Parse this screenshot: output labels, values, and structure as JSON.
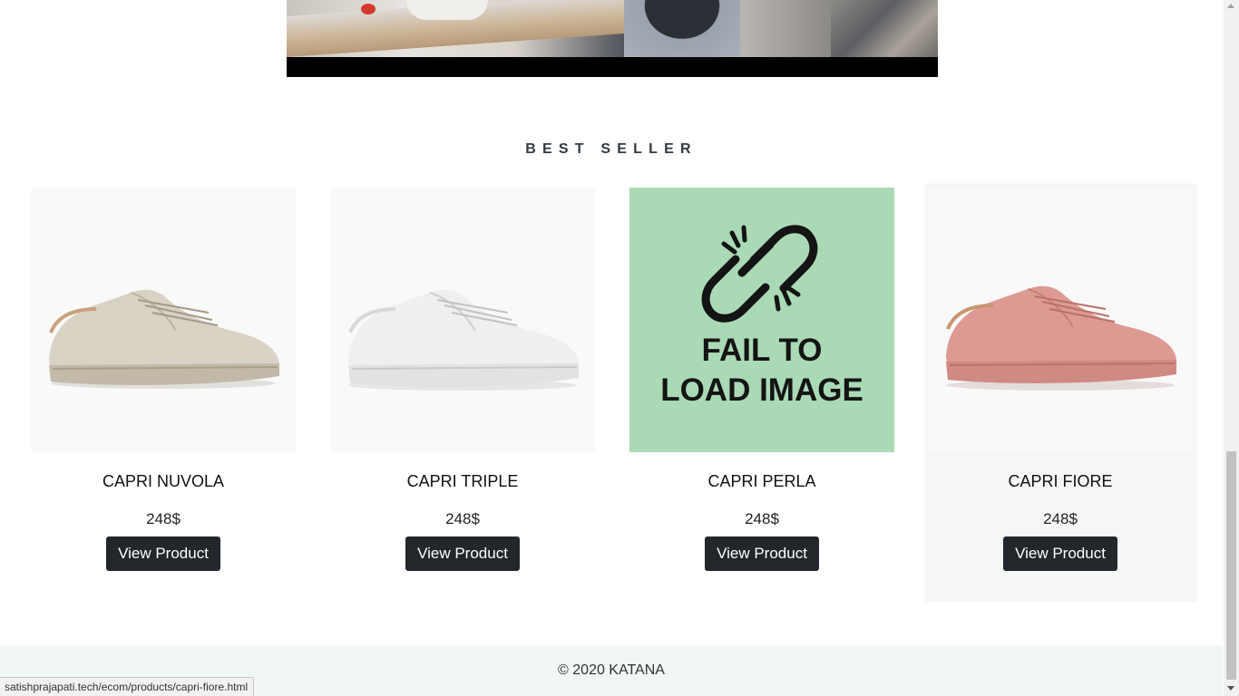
{
  "section": {
    "title": "BEST SELLER"
  },
  "products": [
    {
      "name": "CAPRI NUVOLA",
      "price": "248$",
      "button_label": "View Product",
      "image": "shoe-beige",
      "color": "#d9d3c6"
    },
    {
      "name": "CAPRI TRIPLE",
      "price": "248$",
      "button_label": "View Product",
      "image": "shoe-white",
      "color": "#ededed"
    },
    {
      "name": "CAPRI PERLA",
      "price": "248$",
      "button_label": "View Product",
      "image": "broken-link-icon",
      "fail_line1": "FAIL TO",
      "fail_line2": "LOAD IMAGE"
    },
    {
      "name": "CAPRI FIORE",
      "price": "248$",
      "button_label": "View Product",
      "image": "shoe-pink",
      "color": "#dd9a93"
    }
  ],
  "footer": {
    "text": "© 2020 KATANA"
  },
  "status_bar": {
    "url": "satishprajapati.tech/ecom/products/capri-fiore.html"
  },
  "colors": {
    "button_bg": "#23262b",
    "fail_bg": "#a9dab5",
    "footer_bg": "#f1f6f6"
  }
}
